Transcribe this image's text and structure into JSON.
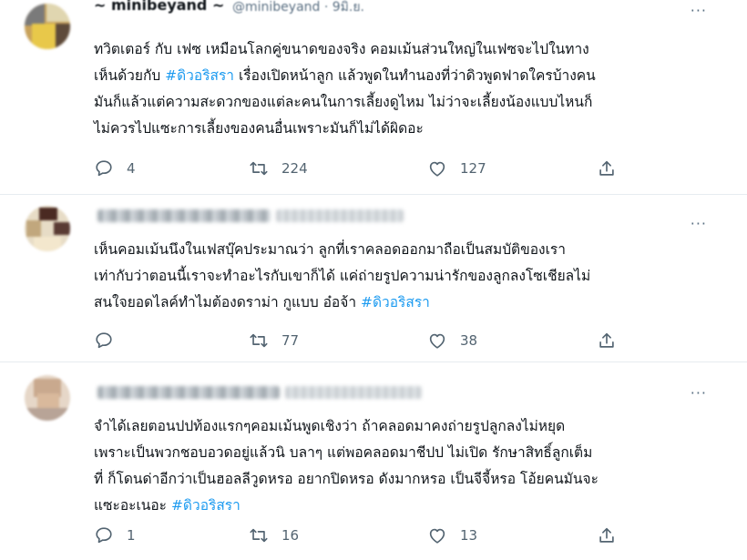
{
  "tweets": [
    {
      "author_name": "~ minibeyand ~",
      "handle_time": "@minibeyand · 9มิ.ย.",
      "lines": [
        "ทวิตเตอร์ กับ เฟซ เหมือนโลกคู่ขนาดของจริง คอมเม้นส่วนใหญ่ในเฟซจะไปในทาง",
        [
          "เห็นด้วยกับ ",
          "#ดิวอริสรา",
          " เรื่องเปิดหน้าลูก แล้วพูดในทำนองที่ว่าดิวพูดฟาดใครบ้างคน"
        ],
        "มันก็แล้วแต่ความสะดวกของแต่ละคนในการเลี้ยงดูไหม ไม่ว่าจะเลี้ยงน้องแบบไหนก็",
        "ไม่ควรไปแซะการเลี้ยงของคนอื่นเพราะมันก็ไม่ได้ผิดอะ"
      ],
      "reply_count": "4",
      "retweet_count": "224",
      "like_count": "127"
    },
    {
      "author_name": "",
      "handle_time": "",
      "lines": [
        "เห็นคอมเม้นนึงในเฟสบุ๊คประมาณว่า ลูกที่เราคลอดออกมาถือเป็นสมบัติของเรา",
        "เท่ากับว่าตอนนี้เราจะทำอะไรกับเขาก็ได้ แค่ถ่ายรูปความน่ารักของลูกลงโซเชียลไม่",
        [
          "สนใจยอดไลค์ทำไมต้องดราม่า กูแบบ อ๋อจ้า ",
          "#ดิวอริสรา",
          ""
        ]
      ],
      "reply_count": "",
      "retweet_count": "77",
      "like_count": "38"
    },
    {
      "author_name": "",
      "handle_time": "",
      "lines": [
        "จำได้เลยตอนปปท้องแรกๆคอมเม้นพูดเชิงว่า ถ้าคลอดมาคงถ่ายรูปลูกลงไม่หยุด",
        "เพราะเป็นพวกชอบอวดอยู่แล้วนิ บลาๆ แต่พอคลอดมาชีปป ไม่เปิด รักษาสิทธิ์ลูกเต็ม",
        "ที่ ก็โดนด่าอีกว่าเป็นฮอลลีวูดหรอ อยากปิดหรอ ดังมากหรอ เป็นจีจี้หรอ โอ้ยคนมันจะ",
        [
          "แซะอะเนอะ ",
          "#ดิวอริสรา",
          ""
        ]
      ],
      "reply_count": "1",
      "retweet_count": "16",
      "like_count": "13"
    }
  ],
  "icons": {
    "more": "more-dots-icon",
    "reply": "reply-bubble-icon",
    "retweet": "retweet-icon",
    "like": "heart-icon",
    "share": "share-icon"
  },
  "colors": {
    "hashtag": "#1d9bf0",
    "muted": "#536471",
    "separator": "#e6ecf0"
  }
}
